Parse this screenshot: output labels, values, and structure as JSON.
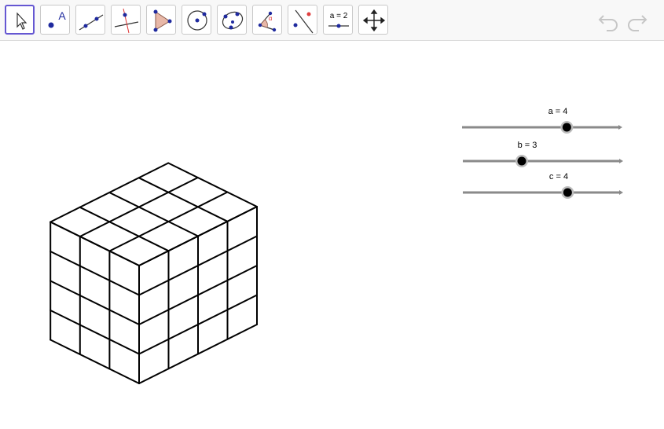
{
  "toolbar": {
    "tools": [
      {
        "name": "move-tool",
        "icon": "pointer-arrow-icon",
        "selected": true
      },
      {
        "name": "point-tool",
        "icon": "point-with-label-icon",
        "text": "A"
      },
      {
        "name": "line-tool",
        "icon": "line-through-points-icon"
      },
      {
        "name": "perpendicular-line-tool",
        "icon": "perpendicular-line-icon"
      },
      {
        "name": "polygon-tool",
        "icon": "polygon-icon"
      },
      {
        "name": "circle-tool",
        "icon": "circle-center-point-icon"
      },
      {
        "name": "conic-tool",
        "icon": "conic-through-points-icon"
      },
      {
        "name": "angle-tool",
        "icon": "angle-icon",
        "text": "α"
      },
      {
        "name": "reflect-tool",
        "icon": "reflect-about-line-icon"
      },
      {
        "name": "slider-tool",
        "icon": "slider-icon",
        "text": "a = 2"
      },
      {
        "name": "move-graphics-view-tool",
        "icon": "move-graphics-view-icon"
      }
    ],
    "undo_icon": "undo-icon",
    "redo_icon": "redo-icon"
  },
  "sliders": [
    {
      "label": "a = 4",
      "value": 4,
      "min": 0,
      "max": 6
    },
    {
      "label": "b = 3",
      "value": 3,
      "min": 0,
      "max": 8
    },
    {
      "label": "c = 4",
      "value": 4,
      "min": 0,
      "max": 6
    }
  ],
  "cube": {
    "a": 4,
    "b": 3,
    "c": 4
  },
  "colors": {
    "selected_tool_border": "#6557d2",
    "point_blue": "#1f2a9e",
    "slider_track": "#8a8a8a",
    "polygon_fill": "#e8b8a8"
  }
}
